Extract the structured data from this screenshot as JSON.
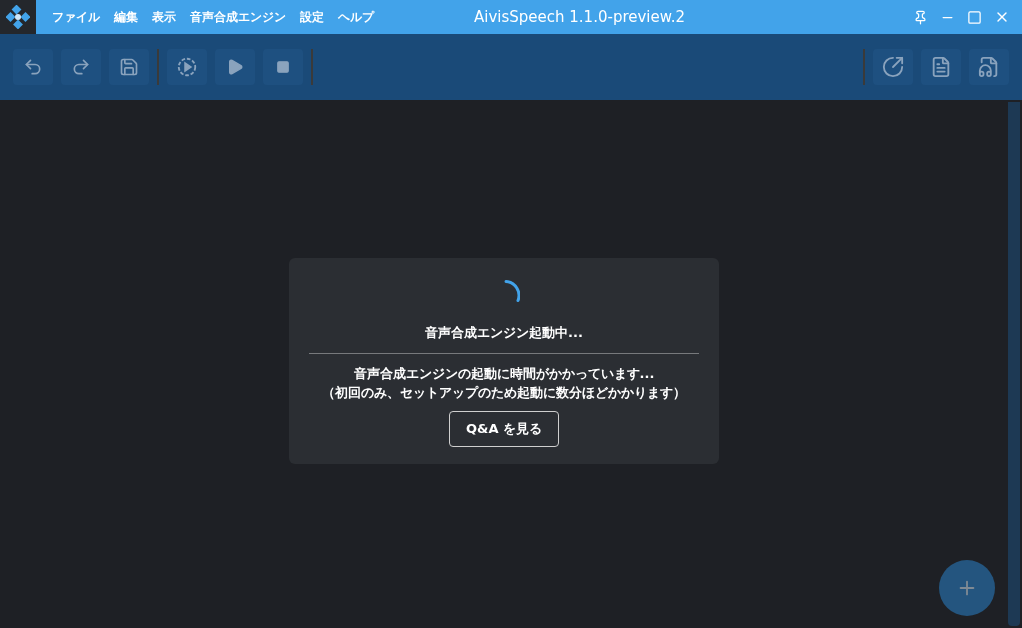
{
  "window": {
    "title": "AivisSpeech 1.1.0-preview.2"
  },
  "menu": [
    "ファイル",
    "編集",
    "表示",
    "音声合成エンジン",
    "設定",
    "ヘルプ"
  ],
  "dialog": {
    "title": "音声合成エンジン起動中...",
    "message": [
      "音声合成エンジンの起動に時間がかかっています...",
      "（初回のみ、セットアップのため起動に数分ほどかかります）"
    ],
    "button": "Q&A を見る"
  }
}
